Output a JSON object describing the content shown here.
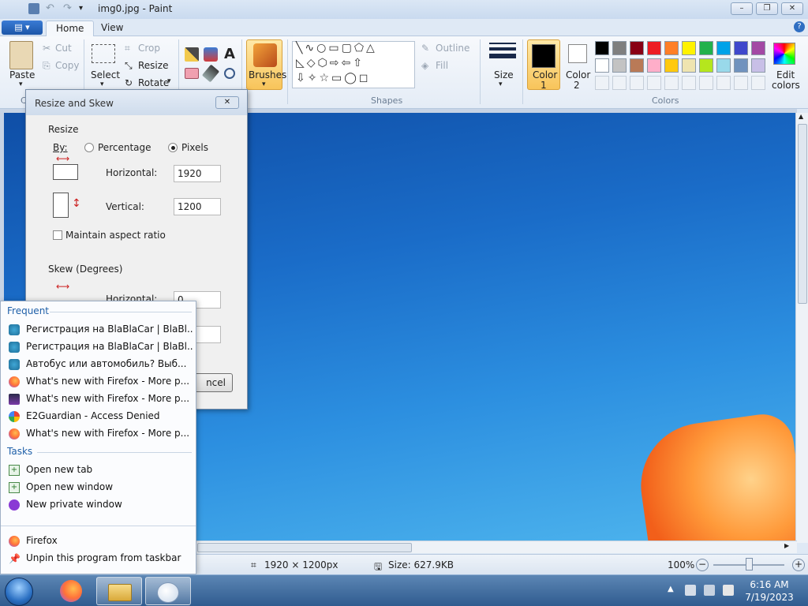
{
  "window": {
    "title": "img0.jpg - Paint",
    "minimize": "–",
    "maximize": "❐",
    "close": "✕"
  },
  "tabs": {
    "menu": "▤ ▾",
    "home": "Home",
    "view": "View"
  },
  "ribbon": {
    "clipboard": {
      "paste": "Paste",
      "cut": "Cut",
      "copy": "Copy",
      "label": "C"
    },
    "image": {
      "select": "Select",
      "crop": "Crop",
      "resize": "Resize",
      "rotate": "Rotate"
    },
    "tools": {
      "text_icon": "A"
    },
    "brushes": "Brushes",
    "shapes": {
      "outline": "Outline",
      "fill": "Fill",
      "label": "Shapes"
    },
    "size": "Size",
    "color1": {
      "line1": "Color",
      "line2": "1"
    },
    "color2": {
      "line1": "Color",
      "line2": "2"
    },
    "colors_label": "Colors",
    "edit_colors": {
      "line1": "Edit",
      "line2": "colors"
    },
    "palette": [
      "#000000",
      "#7f7f7f",
      "#880015",
      "#ed1c24",
      "#ff7f27",
      "#fff200",
      "#22b14c",
      "#00a2e8",
      "#3f48cc",
      "#a349a4",
      "#ffffff",
      "#c3c3c3",
      "#b97a57",
      "#ffaec9",
      "#ffc90e",
      "#efe4b0",
      "#b5e61d",
      "#99d9ea",
      "#7092be",
      "#c8bfe7"
    ]
  },
  "dialog": {
    "title": "Resize and Skew",
    "close": "✕",
    "resize_label": "Resize",
    "by_label": "By:",
    "percentage": "Percentage",
    "pixels": "Pixels",
    "horizontal_label": "Horizontal:",
    "horizontal_value": "1920",
    "vertical_label": "Vertical:",
    "vertical_value": "1200",
    "maintain": "Maintain aspect ratio",
    "skew_label": "Skew (Degrees)",
    "skew_h_label": "Horizontal:",
    "skew_h_value": "0",
    "cancel": "ncel"
  },
  "jumplist": {
    "frequent": "Frequent",
    "items": [
      "Регистрация на BlaBlaCar | BlaBl...",
      "Регистрация на BlaBlaCar | BlaBl...",
      "Автобус или автомобиль? Выб...",
      "What's new with Firefox - More p...",
      "What's new with Firefox - More p...",
      "E2Guardian - Access Denied",
      "What's new with Firefox - More p..."
    ],
    "tasks": "Tasks",
    "task_items": [
      "Open new tab",
      "Open new window",
      "New private window"
    ],
    "app": "Firefox",
    "unpin": "Unpin this program from taskbar"
  },
  "status": {
    "dimensions": "1920 × 1200px",
    "size": "Size: 627.9KB",
    "zoom": "100%"
  },
  "taskbar": {
    "time": "6:16 AM",
    "date": "7/19/2023"
  }
}
